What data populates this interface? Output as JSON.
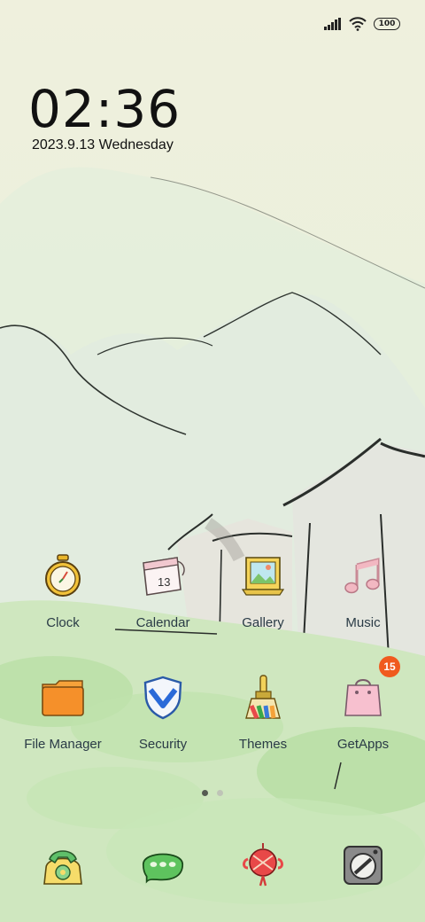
{
  "status_bar": {
    "battery": "100",
    "icons": [
      "signal-icon",
      "wifi-icon",
      "battery-icon"
    ]
  },
  "lockclock": {
    "time": "02:36",
    "date": "2023.9.13 Wednesday"
  },
  "apps": [
    {
      "label": "Clock",
      "icon": "clock-icon"
    },
    {
      "label": "Calendar",
      "icon": "calendar-icon",
      "day": "13"
    },
    {
      "label": "Gallery",
      "icon": "gallery-icon"
    },
    {
      "label": "Music",
      "icon": "music-icon"
    },
    {
      "label": "File Manager",
      "icon": "folder-icon"
    },
    {
      "label": "Security",
      "icon": "security-shield-icon"
    },
    {
      "label": "Themes",
      "icon": "paintbrush-icon"
    },
    {
      "label": "GetApps",
      "icon": "shopping-bag-icon",
      "badge": "15"
    }
  ],
  "page_indicator": {
    "pages": 2,
    "current": 1
  },
  "dock": [
    {
      "icon": "phone-icon"
    },
    {
      "icon": "messages-icon"
    },
    {
      "icon": "browser-icon"
    },
    {
      "icon": "camera-icon"
    }
  ]
}
